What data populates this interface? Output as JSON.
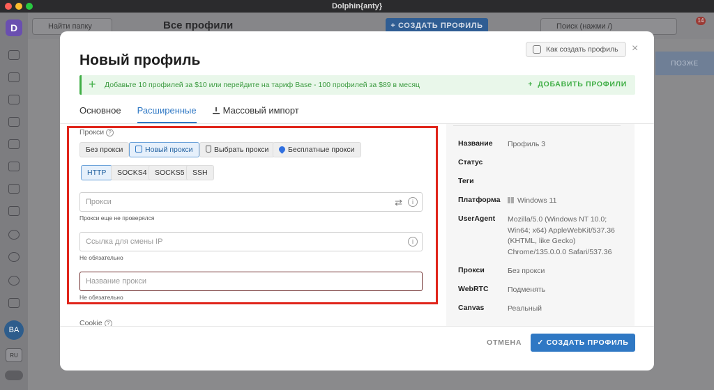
{
  "window": {
    "title": "Dolphin{anty}"
  },
  "background": {
    "logo_letter": "D",
    "folder_search_placeholder": "Найти папку",
    "page_title": "Все профили",
    "create_profile_button": "+ СОЗДАТЬ ПРОФИЛЬ",
    "search_placeholder": "Поиск (нажми /)",
    "notifications_count": "14",
    "user_initials": "BA",
    "language": "RU",
    "later_button": "ПОЗЖЕ"
  },
  "modal": {
    "title": "Новый профиль",
    "how_to_button": "Как создать профиль",
    "close": "×",
    "promo": {
      "text": "Добавьте 10 профилей за $10 или перейдите на тариф Base - 100 профилей за $89 в месяц",
      "action": "ДОБАВИТЬ ПРОФИЛИ"
    },
    "tabs": [
      "Основное",
      "Расширенные",
      "Массовый импорт"
    ],
    "proxy": {
      "label": "Прокси",
      "modes": [
        "Без прокси",
        "Новый прокси",
        "Выбрать прокси",
        "Бесплатные прокси"
      ],
      "types": [
        "HTTP",
        "SOCKS4",
        "SOCKS5",
        "SSH"
      ],
      "proxy_placeholder": "Прокси",
      "proxy_hint": "Прокси еще не проверялся",
      "ip_change_placeholder": "Ссылка для смены IP",
      "ip_change_hint": "Не обязательно",
      "name_placeholder": "Название прокси",
      "name_hint": "Не обязательно"
    },
    "cookie_label": "Cookie",
    "summary": [
      {
        "key": "Название",
        "value": "Профиль 3"
      },
      {
        "key": "Статус",
        "value": ""
      },
      {
        "key": "Теги",
        "value": ""
      },
      {
        "key": "Платформа",
        "value": "Windows 11"
      },
      {
        "key": "UserAgent",
        "value": "Mozilla/5.0 (Windows NT 10.0; Win64; x64) AppleWebKit/537.36 (KHTML, like Gecko) Chrome/135.0.0.0 Safari/537.36"
      },
      {
        "key": "Прокси",
        "value": "Без прокси"
      },
      {
        "key": "WebRTC",
        "value": "Подменять"
      },
      {
        "key": "Canvas",
        "value": "Реальный"
      }
    ],
    "cancel_button": "ОТМЕНА",
    "submit_button": "СОЗДАТЬ ПРОФИЛЬ"
  },
  "colors": {
    "accent": "#2f78c4",
    "promo_green": "#3fae45",
    "highlight_red": "#e0251b"
  }
}
